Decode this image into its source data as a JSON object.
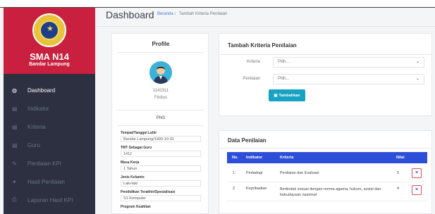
{
  "sidebar": {
    "brand_title": "SMA N14",
    "brand_subtitle": "Bandar Lampung",
    "items": [
      {
        "label": "Dashboard",
        "icon": "dashboard-icon"
      },
      {
        "label": "Indikator",
        "icon": "list-icon"
      },
      {
        "label": "Kriteria",
        "icon": "list-icon"
      },
      {
        "label": "Guru",
        "icon": "list-icon"
      },
      {
        "label": "Penilaian KPI",
        "icon": "edit-icon"
      },
      {
        "label": "Hasil Penilaian",
        "icon": "bulb-icon"
      },
      {
        "label": "Laporan Hasil KPI",
        "icon": "report-icon"
      }
    ]
  },
  "header": {
    "title": "Dashboard",
    "breadcrumb_home": "Beranda",
    "breadcrumb_sep": "/",
    "breadcrumb_current": "Tambah Kriteria Penilaian"
  },
  "profile": {
    "title": "Profile",
    "nip": "1142311",
    "name": "Firdius",
    "status": "PNS",
    "fields": [
      {
        "label": "Tempat/Tanggal Lahir",
        "value": "Bandar Lampung/1990-10-31"
      },
      {
        "label": "TMT Sebagai Guru",
        "value": "1412"
      },
      {
        "label": "Masa Kerja",
        "value": "1 Tahun"
      },
      {
        "label": "Jenis Kelamin",
        "value": "Laki-laki"
      },
      {
        "label": "Pendidikan Terakhir/Spesialisasi",
        "value": "S1 Komputer"
      },
      {
        "label": "Program Keahlian",
        "value": ""
      }
    ]
  },
  "form": {
    "title": "Tambah Kriteria Penilaian",
    "kriteria_label": "Kriteria",
    "kriteria_value": "Pilih...",
    "penilaian_label": "Penilaian",
    "penilaian_value": "Pilih...",
    "submit_label": "Tambahkan"
  },
  "table": {
    "title": "Data Penilaian",
    "headers": {
      "no": "No.",
      "indikator": "Indikator",
      "kriteria": "Kriteria",
      "nilai": "Nilai"
    },
    "rows": [
      {
        "no": "1",
        "indikator": "Pedadogi",
        "kriteria": "Penilaian dan Evaluasi",
        "nilai": "5"
      },
      {
        "no": "2",
        "indikator": "Kepribadian",
        "kriteria": "Bertindak sesuai dengan norma agama, hukum, sosial dan kebudayaan nasional",
        "nilai": "4"
      }
    ],
    "delete_glyph": "×"
  },
  "colors": {
    "brand_red": "#c8203e",
    "sidebar_bg": "#2c3040",
    "table_header": "#2d4ed8",
    "button_teal": "#17a2c4",
    "avatar_bg": "#3bb3d8"
  }
}
